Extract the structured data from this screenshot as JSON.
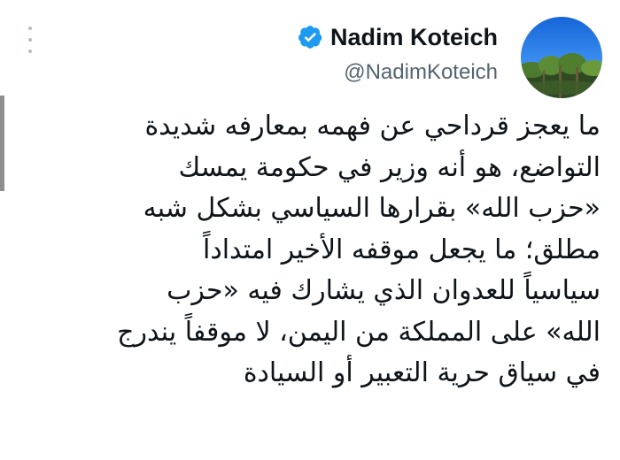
{
  "tweet": {
    "author": {
      "display_name": "Nadim Koteich",
      "handle": "@NadimKoteich",
      "verified": true
    },
    "text": "ما يعجز قرداحي عن فهمه بمعارفه شديدة\nالتواضع، هو أنه وزير في حكومة يمسك\n«حزب الله» بقرارها السياسي بشكل شبه\nمطلق؛ ما يجعل موقفه الأخير امتداداً\nسياسياً للعدوان الذي يشارك فيه «حزب\nالله» على المملكة من اليمن، لا موقفاً يندرج\nفي سياق حرية التعبير أو السيادة"
  },
  "icons": {
    "more": "more-vertical-icon",
    "verified": "verified-badge-icon"
  },
  "colors": {
    "text": "#0f1419",
    "secondary": "#536471",
    "verified_blue": "#1d9bf0"
  }
}
